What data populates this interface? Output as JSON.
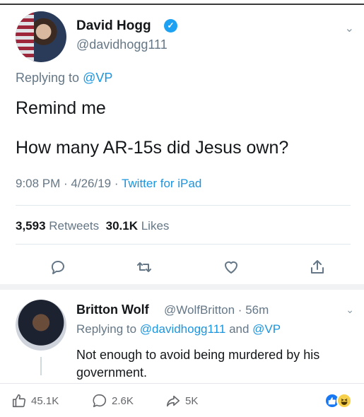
{
  "tweet": {
    "author_name": "David Hogg",
    "author_handle": "@davidhogg111",
    "replying_prefix": "Replying to ",
    "replying_to": "@VP",
    "line1": "Remind me",
    "line2": "How many AR-15s did Jesus own?",
    "time_date": "9:08 PM · 4/26/19 · ",
    "source": "Twitter for iPad",
    "retweets_count": "3,593",
    "retweets_label": "Retweets",
    "likes_count": "30.1K",
    "likes_label": "Likes"
  },
  "reply": {
    "author_name": "Britton Wolf",
    "author_handle": "@WolfBritton · 56m",
    "replying_prefix": "Replying to ",
    "replying_to_1": "@davidhogg111",
    "replying_and": " and ",
    "replying_to_2": "@VP",
    "text": "Not enough to avoid being murdered by his government."
  },
  "facebook_bar": {
    "likes": "45.1K",
    "comments": "2.6K",
    "shares": "5K"
  },
  "colors": {
    "twitter_blue": "#1da1f2",
    "link_blue": "#1b95e0",
    "muted": "#657786"
  },
  "icons": [
    "verified-badge-icon",
    "chevron-down-icon",
    "reply-icon",
    "retweet-icon",
    "heart-icon",
    "share-icon",
    "thumbs-up-icon",
    "comment-icon",
    "share-arrow-icon",
    "like-reaction-icon",
    "haha-reaction-icon"
  ]
}
